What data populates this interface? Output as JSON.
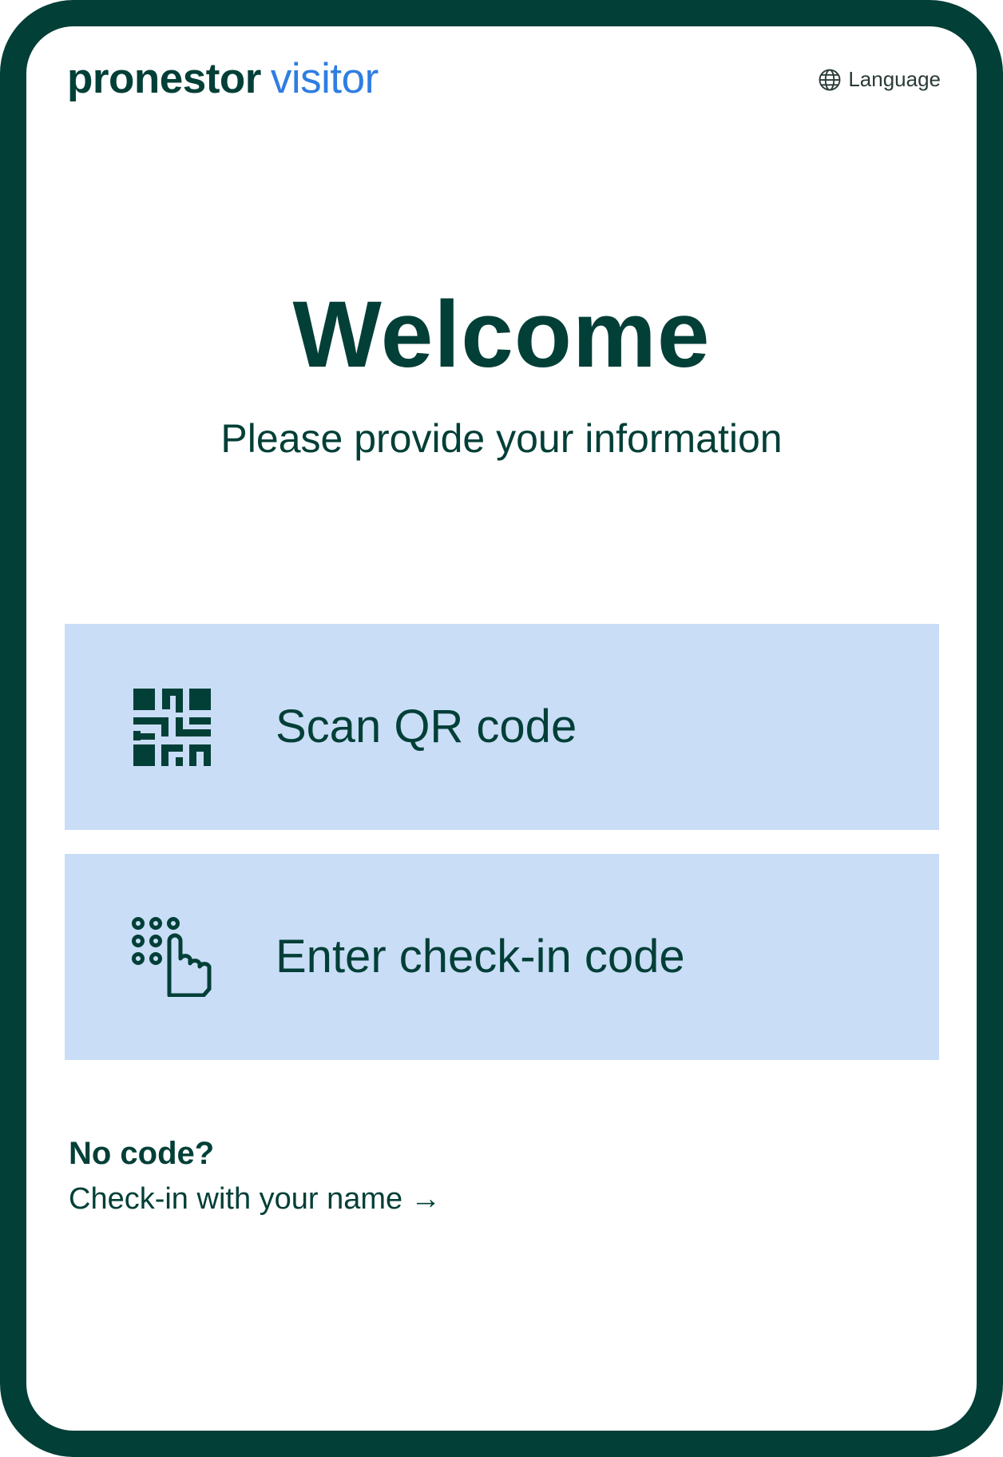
{
  "brand": {
    "main": "pronestor",
    "sub": "visitor"
  },
  "header": {
    "language_label": "Language",
    "language_icon": "globe-icon"
  },
  "main": {
    "title": "Welcome",
    "subtitle": "Please provide your information"
  },
  "options": [
    {
      "label": "Scan QR code",
      "icon": "qr-code-icon"
    },
    {
      "label": "Enter check-in code",
      "icon": "keypad-touch-icon"
    }
  ],
  "fallback": {
    "heading": "No code?",
    "link_label": "Check-in with your name",
    "link_arrow": "→"
  },
  "colors": {
    "primary_dark_green": "#023f37",
    "brand_blue": "#2f7de1",
    "option_background": "#c9ddf7",
    "page_background": "#ffffff"
  }
}
